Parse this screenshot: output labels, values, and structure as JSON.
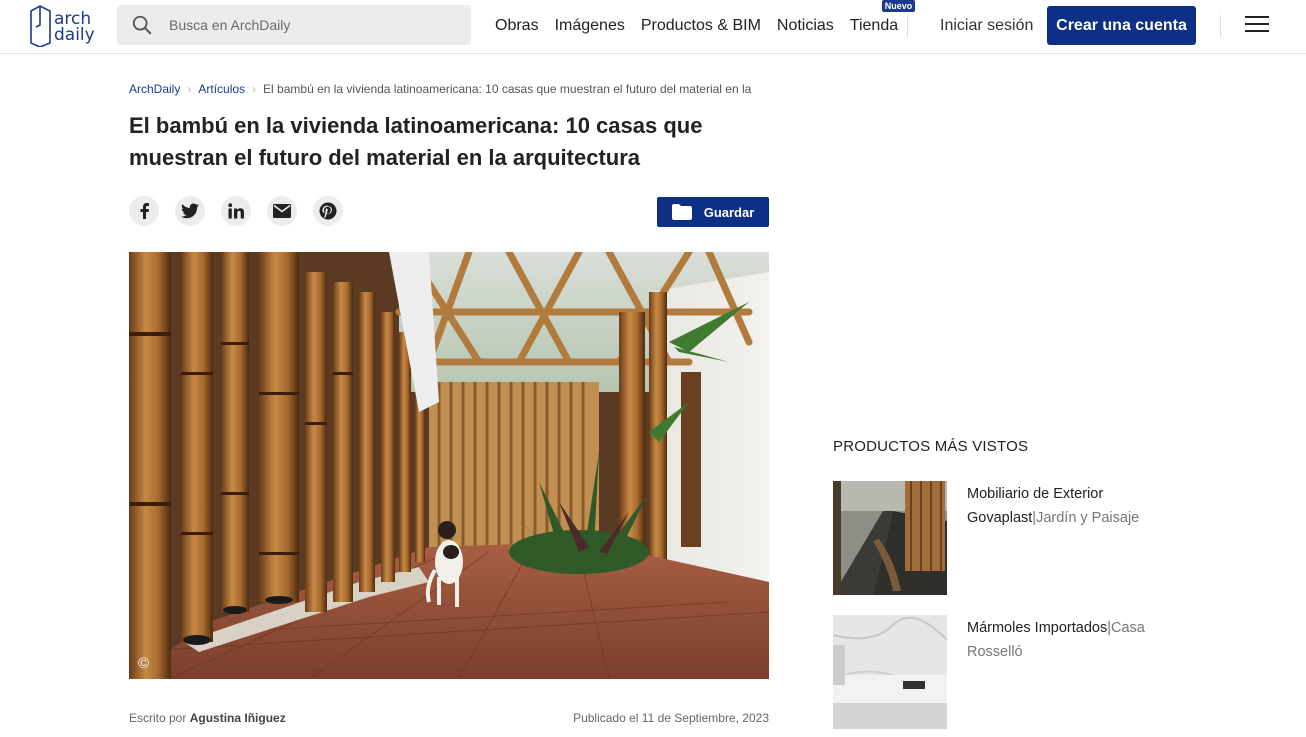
{
  "header": {
    "logo_line1": "arch",
    "logo_line2": "daily",
    "search_placeholder": "Busca en ArchDaily",
    "nav": [
      {
        "label": "Obras"
      },
      {
        "label": "Imágenes"
      },
      {
        "label": "Productos & BIM"
      },
      {
        "label": "Noticias"
      },
      {
        "label": "Tienda",
        "badge": "Nuevo"
      }
    ],
    "login": "Iniciar sesión",
    "signup": "Crear una cuenta"
  },
  "breadcrumb": {
    "home": "ArchDaily",
    "section": "Artículos",
    "current": "El bambú en la vivienda latinoamericana: 10 casas que muestran el futuro del material en la"
  },
  "article": {
    "title": "El bambú en la vivienda latinoamericana: 10 casas que muestran el futuro del material en la arquitectura",
    "save_label": "Guardar",
    "image_credit": "©",
    "written_by": "Escrito por",
    "author": "Agustina Iñiguez",
    "published": "Publicado el 11 de Septiembre, 2023"
  },
  "share": [
    "facebook-icon",
    "twitter-icon",
    "linkedin-icon",
    "mail-icon",
    "pinterest-icon"
  ],
  "sidebar": {
    "title": "PRODUCTOS MÁS VISTOS",
    "products": [
      {
        "name": "Mobiliario de Exterior Govaplast",
        "sep": "|",
        "category": "Jardín y Paisaje"
      },
      {
        "name": "Mármoles Importados",
        "sep": "|",
        "category": "Casa Rosselló"
      }
    ]
  },
  "colors": {
    "brand": "#0d2f86",
    "search_bg": "#ececec"
  }
}
